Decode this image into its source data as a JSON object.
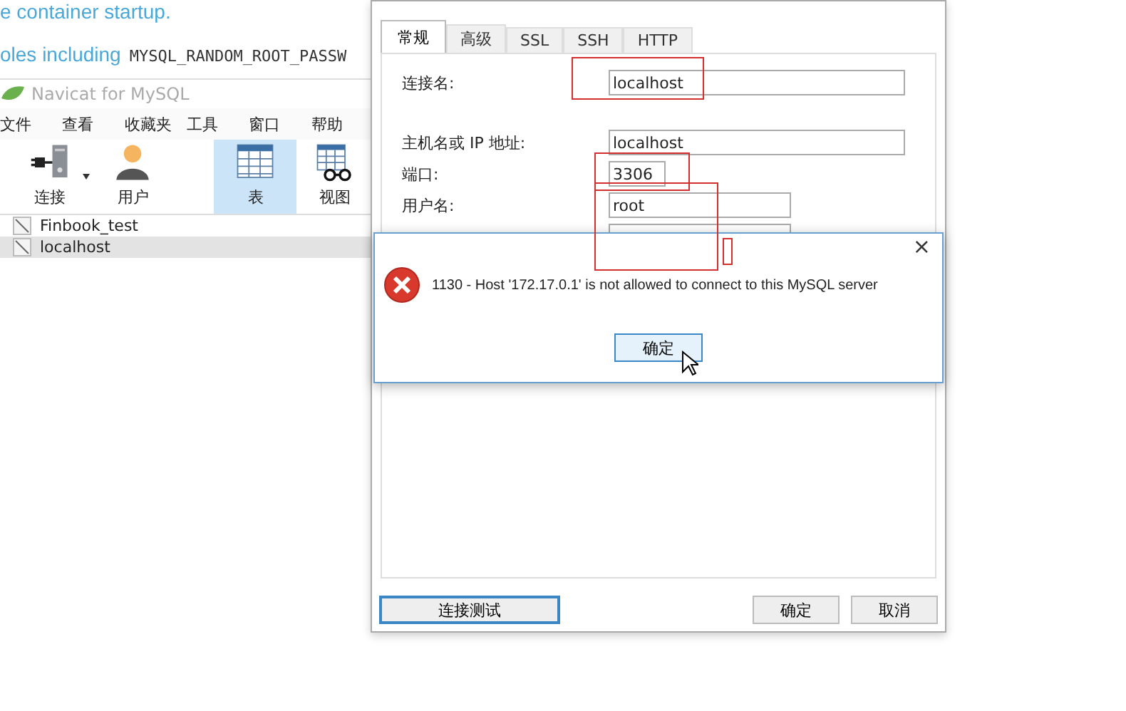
{
  "background_page": {
    "lines": [
      {
        "kind": "text",
        "text": "e container startup."
      },
      {
        "kind": "mixed",
        "text": "oles including",
        "code": "MYSQL_RANDOM_ROOT_PASSW"
      }
    ]
  },
  "main_window": {
    "title": "Navicat for MySQL",
    "menu": [
      "文件",
      "查看",
      "收藏夹",
      "工具",
      "窗口",
      "帮助"
    ],
    "toolbar": [
      {
        "label": "连接",
        "kind": "connect",
        "selected": false
      },
      {
        "label": "用户",
        "kind": "user",
        "selected": false
      },
      {
        "label": "表",
        "kind": "table",
        "selected": true
      },
      {
        "label": "视图",
        "kind": "view",
        "selected": false
      }
    ],
    "connections": [
      {
        "name": "Finbook_test",
        "selected": false
      },
      {
        "name": "localhost",
        "selected": true
      }
    ]
  },
  "connection_dialog": {
    "tabs": [
      {
        "label": "常规",
        "selected": true
      },
      {
        "label": "高级",
        "selected": false
      },
      {
        "label": "SSL",
        "selected": false
      },
      {
        "label": "SSH",
        "selected": false
      },
      {
        "label": "HTTP",
        "selected": false
      }
    ],
    "fields": [
      {
        "label": "连接名:",
        "value": "localhost",
        "kind": "name"
      },
      {
        "label": "主机名或 IP 地址:",
        "value": "localhost",
        "kind": "host"
      },
      {
        "label": "端口:",
        "value": "3306",
        "kind": "port"
      },
      {
        "label": "用户名:",
        "value": "root",
        "kind": "user"
      }
    ],
    "buttons": [
      {
        "label": "连接测试",
        "kind": "left",
        "focused": true
      },
      {
        "label": "确定",
        "kind": "right",
        "focused": false
      },
      {
        "label": "取消",
        "kind": "right",
        "focused": false
      }
    ]
  },
  "error_dialog": {
    "message": "1130 - Host '172.17.0.1' is not allowed to connect to this MySQL server",
    "close": "×",
    "button": "确定"
  }
}
